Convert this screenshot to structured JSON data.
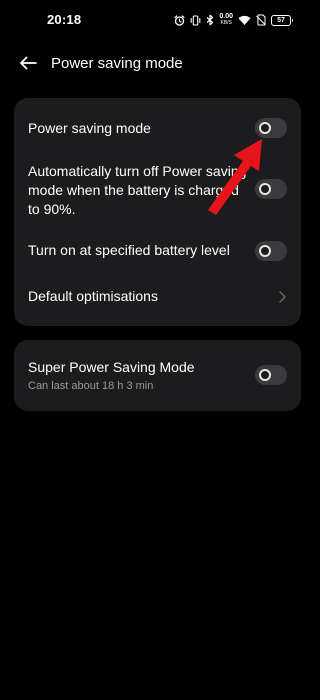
{
  "status_bar": {
    "time": "20:18",
    "net_speed_value": "0.00",
    "net_speed_unit": "KB/S",
    "battery_level": "57"
  },
  "header": {
    "title": "Power saving mode"
  },
  "settings_card": {
    "power_saving_mode": {
      "label": "Power saving mode",
      "enabled": false
    },
    "auto_turn_off": {
      "label": "Automatically turn off Power saving mode when the battery is charged to 90%.",
      "enabled": false
    },
    "turn_on_at_level": {
      "label": "Turn on at specified battery level",
      "enabled": false
    },
    "default_optimisations": {
      "label": "Default optimisations"
    }
  },
  "super_card": {
    "label": "Super Power Saving Mode",
    "sublabel": "Can last about 18 h 3 min",
    "enabled": false
  },
  "colors": {
    "background": "#000000",
    "card": "#1c1c1e",
    "toggle_track": "#3b3b3d",
    "annotation_arrow": "#e8141b"
  }
}
